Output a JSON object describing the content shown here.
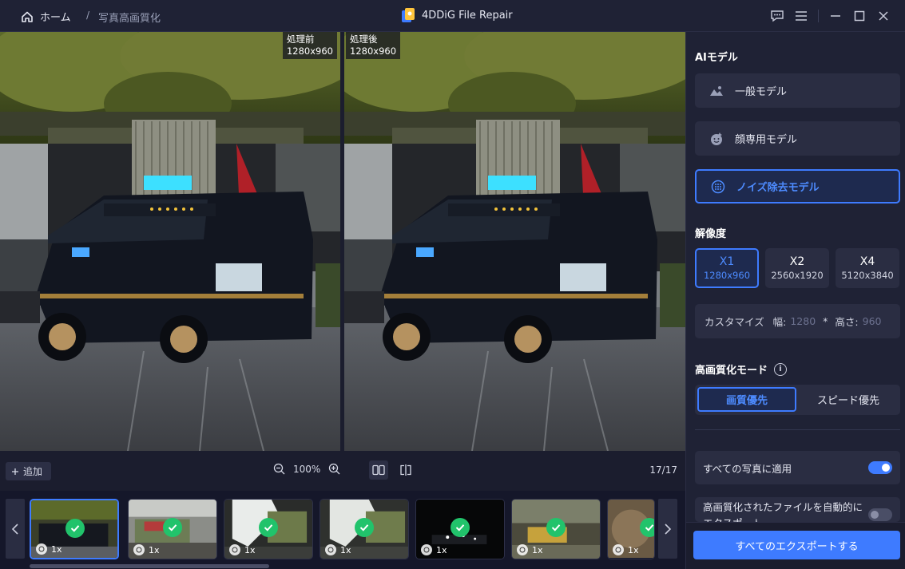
{
  "titlebar": {
    "home_label": "ホーム",
    "separator": "/",
    "breadcrumb": "写真高画質化",
    "app_title": "4DDiG File Repair"
  },
  "preview": {
    "before_label": "処理前",
    "before_size": "1280x960",
    "after_label": "処理後",
    "after_size": "1280x960"
  },
  "toolbar": {
    "add_label": "追加",
    "zoom_level": "100%",
    "counter": "17/17"
  },
  "thumbnails": [
    {
      "scale": "1x",
      "selected": true
    },
    {
      "scale": "1x",
      "selected": false
    },
    {
      "scale": "1x",
      "selected": false
    },
    {
      "scale": "1x",
      "selected": false
    },
    {
      "scale": "1x",
      "selected": false
    },
    {
      "scale": "1x",
      "selected": false
    },
    {
      "scale": "1x",
      "selected": false
    }
  ],
  "panel": {
    "ai_model_title": "AIモデル",
    "models": [
      {
        "label": "一般モデル",
        "icon": "landscape-icon",
        "active": false
      },
      {
        "label": "顔専用モデル",
        "icon": "face-icon",
        "active": false
      },
      {
        "label": "ノイズ除去モデル",
        "icon": "denoise-icon",
        "active": true
      }
    ],
    "resolution_title": "解像度",
    "resolutions": [
      {
        "label": "X1",
        "size": "1280x960",
        "active": true
      },
      {
        "label": "X2",
        "size": "2560x1920",
        "active": false
      },
      {
        "label": "X4",
        "size": "5120x3840",
        "active": false
      }
    ],
    "custom": {
      "label": "カスタマイズ",
      "width_label": "幅:",
      "width_value": "1280",
      "times": "*",
      "height_label": "高さ:",
      "height_value": "960"
    },
    "mode_title": "高画質化モード",
    "modes": [
      {
        "label": "画質優先",
        "active": true
      },
      {
        "label": "スピード優先",
        "active": false
      }
    ],
    "apply_all_label": "すべての写真に適用",
    "apply_all_on": true,
    "auto_export_label": "高画質化されたファイルを自動的にエクスポート",
    "auto_export_on": false,
    "export_button": "すべてのエクスポートする"
  },
  "colors": {
    "accent": "#3e7bff",
    "success": "#21c36b",
    "panel_bg": "#1f2235"
  }
}
